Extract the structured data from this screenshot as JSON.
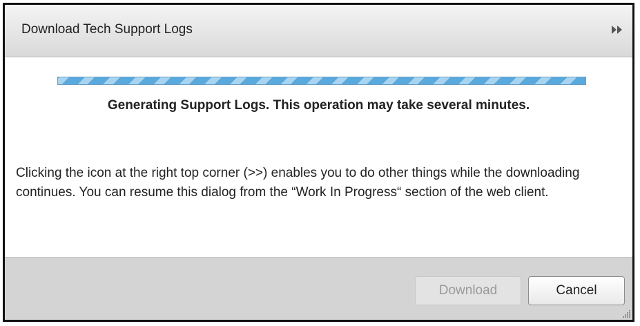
{
  "dialog": {
    "title": "Download Tech Support Logs",
    "minimize_icon": "double-chevron-right-icon",
    "progress": {
      "indeterminate": true,
      "colors": {
        "stripe": "#5aa9dd",
        "light": "#a8d4f1"
      }
    },
    "status_text": "Generating Support Logs. This operation may take several minutes.",
    "info_text": "Clicking the icon at the right top corner (>>) enables you to do other things while the downloading continues. You can resume this dialog from the “Work In Progress“ section of the web client.",
    "buttons": {
      "download_label": "Download",
      "download_enabled": false,
      "cancel_label": "Cancel"
    },
    "resize_icon": "resize-grip-icon"
  }
}
